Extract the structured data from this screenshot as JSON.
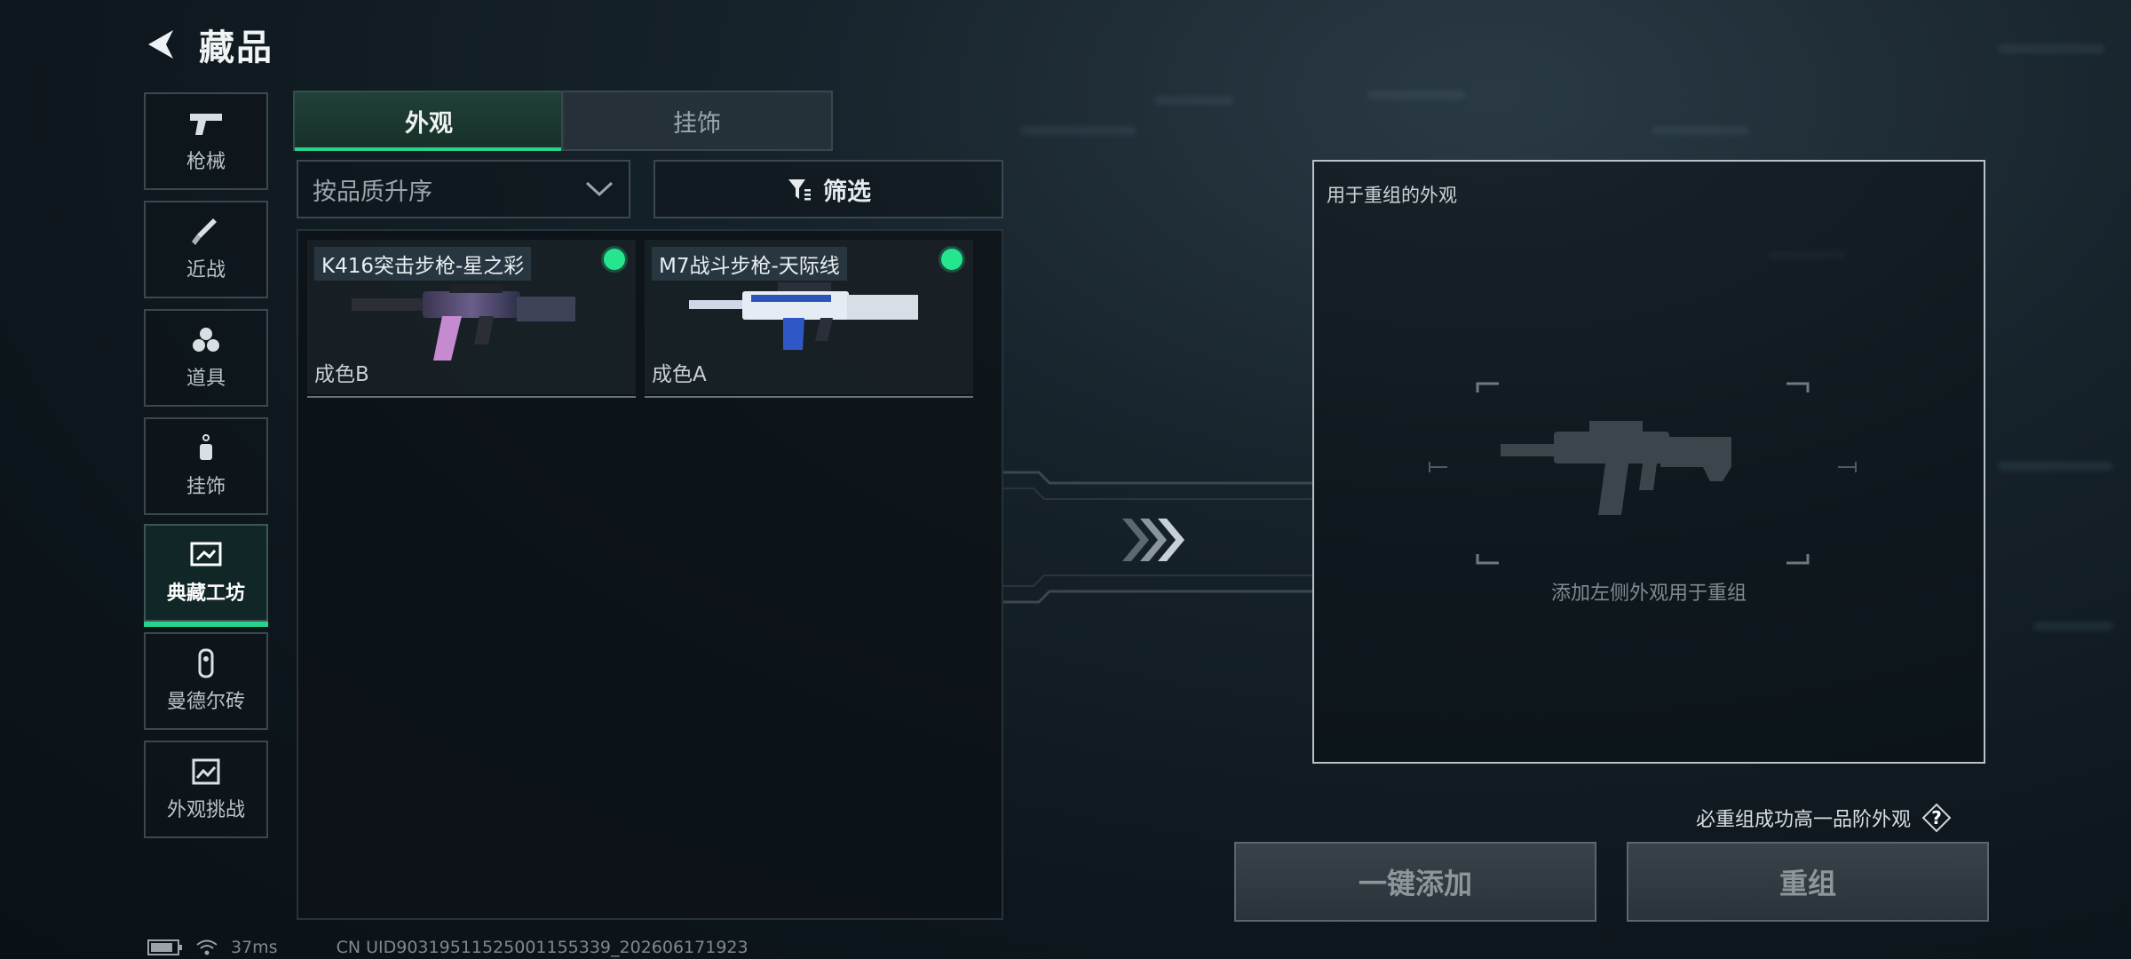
{
  "header": {
    "title": "藏品",
    "back_icon": "back-arrow-icon"
  },
  "nav": [
    {
      "label": "枪械",
      "icon": "pistol-icon",
      "active": false
    },
    {
      "label": "近战",
      "icon": "knife-icon",
      "active": false
    },
    {
      "label": "道具",
      "icon": "grenade-icon",
      "active": false
    },
    {
      "label": "挂饰",
      "icon": "charm-icon",
      "active": false
    },
    {
      "label": "典藏工坊",
      "icon": "workshop-frame-icon",
      "active": true
    },
    {
      "label": "曼德尔砖",
      "icon": "mandel-brick-icon",
      "active": false
    },
    {
      "label": "外观挑战",
      "icon": "challenge-image-icon",
      "active": false
    }
  ],
  "tabs": [
    {
      "label": "外观",
      "active": true
    },
    {
      "label": "挂饰",
      "active": false
    }
  ],
  "sort": {
    "label": "按品质升序"
  },
  "filter": {
    "label": "筛选",
    "icon": "filter-icon"
  },
  "items": [
    {
      "name": "K416突击步枪-星之彩",
      "grade": "成色B",
      "status_color": "#25e58e"
    },
    {
      "name": "M7战斗步枪-天际线",
      "grade": "成色A",
      "status_color": "#25e58e"
    }
  ],
  "reorg": {
    "title": "用于重组的外观",
    "hint": "添加左侧外观用于重组",
    "guarantee_text": "必重组成功高一品阶外观",
    "help_label": "?",
    "add_all_label": "一键添加",
    "reorg_label": "重组"
  },
  "status": {
    "ping": "37ms",
    "uid": "CN UID903195115250011553​39_202606171923"
  }
}
